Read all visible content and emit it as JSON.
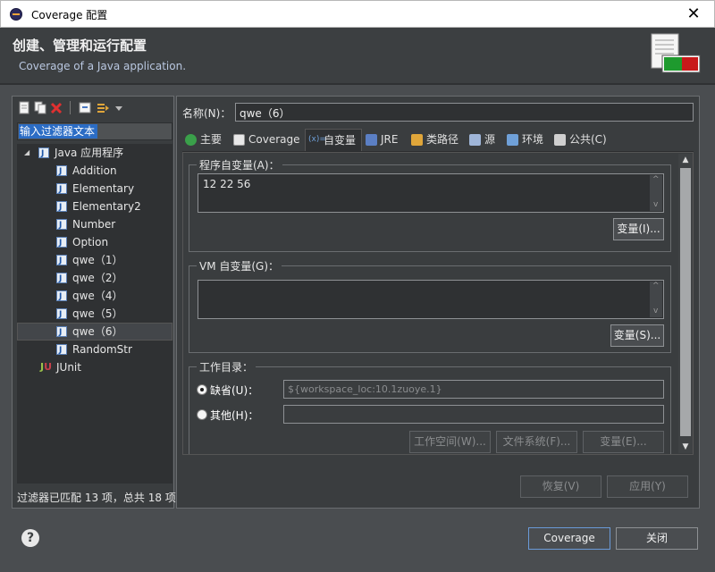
{
  "window": {
    "title": "Coverage 配置",
    "close_glyph": "✕"
  },
  "header": {
    "title": "创建、管理和运行配置",
    "subtitle": "Coverage of a Java application."
  },
  "left": {
    "filter_placeholder": "输入过滤器文本",
    "tree": {
      "root_label": "Java 应用程序",
      "items": [
        "Addition",
        "Elementary",
        "Elementary2",
        "Number",
        "Option",
        "qwe（1）",
        "qwe（2）",
        "qwe（4）",
        "qwe（5）",
        "qwe（6）",
        "RandomStr"
      ],
      "selected": "qwe（6）",
      "junit_label": "JUnit",
      "junit_icon_text": {
        "j": "J",
        "u": "U"
      }
    },
    "status": "过滤器已匹配 13 项，总共 18 项"
  },
  "right": {
    "name_label": "名称(N)：",
    "name_value": "qwe（6）",
    "tabs": [
      {
        "label": "主要",
        "icon": "main-tab-icon",
        "color": "#3aa04a"
      },
      {
        "label": "Coverage",
        "icon": "coverage-tab-icon",
        "color": "#cfcfcf"
      },
      {
        "label": "自变量",
        "icon": "arguments-tab-icon",
        "color": "#6fa0d8"
      },
      {
        "label": "JRE",
        "icon": "jre-tab-icon",
        "color": "#5b7fc4"
      },
      {
        "label": "类路径",
        "icon": "classpath-tab-icon",
        "color": "#e0a63a"
      },
      {
        "label": "源",
        "icon": "source-tab-icon",
        "color": "#9fb5d8"
      },
      {
        "label": "环境",
        "icon": "environment-tab-icon",
        "color": "#6fa0d8"
      },
      {
        "label": "公共(C)",
        "icon": "common-tab-icon",
        "color": "#cfcfcf"
      }
    ],
    "active_tab": "自变量",
    "program_args": {
      "label": "程序自变量(A)：",
      "value": "12 22 56",
      "button": "变量(I)..."
    },
    "vm_args": {
      "label": "VM 自变量(G)：",
      "value": "",
      "button": "变量(S)..."
    },
    "workdir": {
      "label": "工作目录：",
      "default_label": "缺省(U)：",
      "default_value": "${workspace_loc:10.1zuoye.1}",
      "other_label": "其他(H)：",
      "other_value": "",
      "buttons": [
        "工作空间(W)...",
        "文件系统(F)...",
        "变量(E)..."
      ]
    },
    "revert_button": "恢复(V)",
    "apply_button": "应用(Y)"
  },
  "footer": {
    "help_glyph": "?",
    "run_button": "Coverage",
    "close_button": "关闭"
  },
  "colors": {
    "accent": "#2b6cc4",
    "background": "#4a4d50",
    "panel": "#3a3d3f"
  }
}
